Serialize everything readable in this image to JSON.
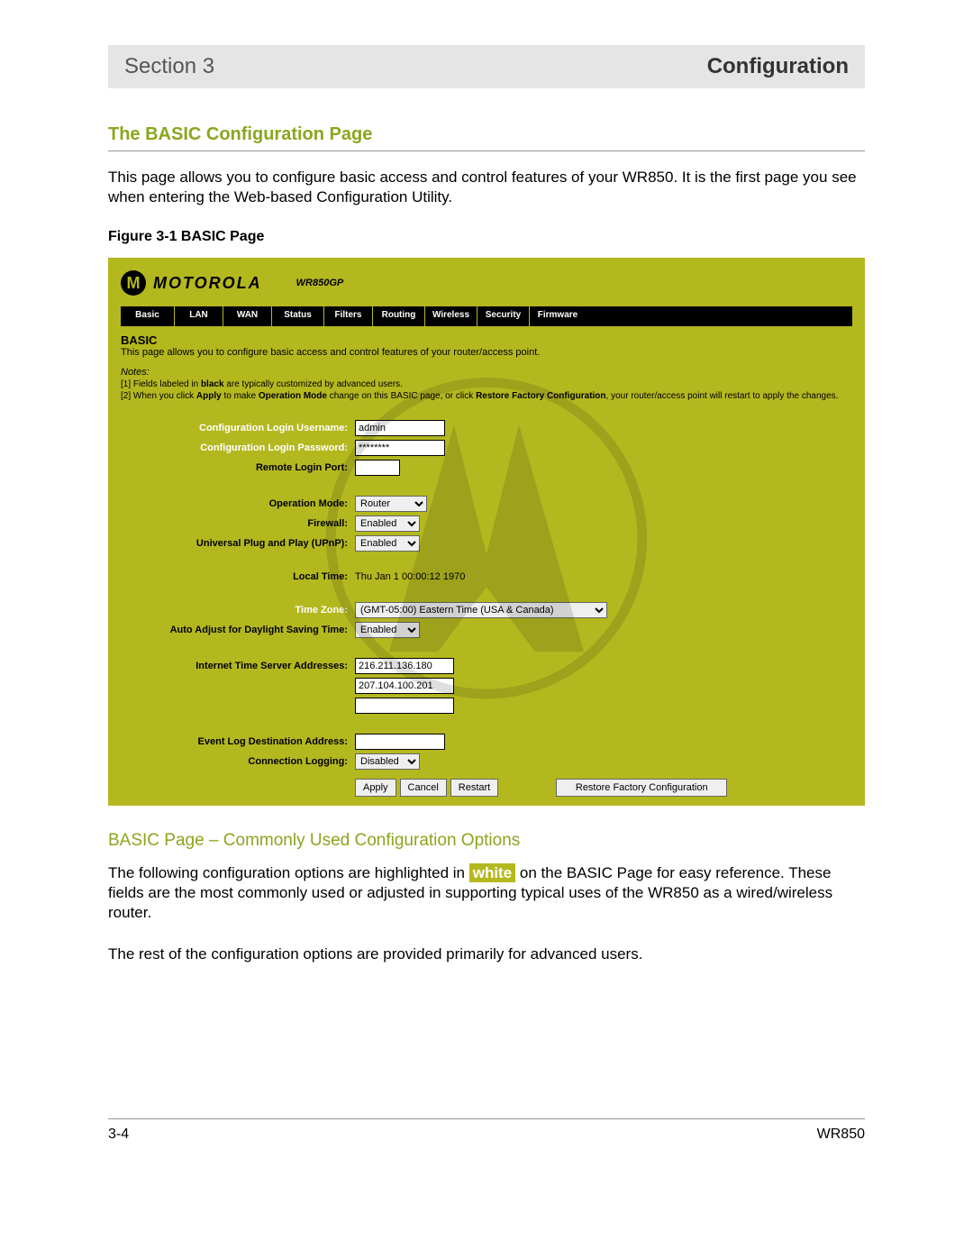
{
  "header": {
    "section_label": "Section 3",
    "module_label": "Configuration"
  },
  "title": "The BASIC Configuration Page",
  "intro": "This page allows you to configure basic access and control features of your WR850.  It is the first page you see when entering the Web-based Configuration Utility.",
  "figure_caption": "Figure 3-1 BASIC Page",
  "router": {
    "brand": "MOTOROLA",
    "model": "WR850GP",
    "tabs": [
      "Basic",
      "LAN",
      "WAN",
      "Status",
      "Filters",
      "Routing",
      "Wireless",
      "Security",
      "Firmware"
    ],
    "section_title": "BASIC",
    "desc": "This page allows you to configure basic access and control features of your router/access point.",
    "notes_label": "Notes:",
    "note1_pre": "[1] Fields labeled in ",
    "note1_bold": "black",
    "note1_post": " are typically customized by advanced users.",
    "note2_pre": "[2] When you click ",
    "note2_apply": "Apply",
    "note2_mid": " to make ",
    "note2_om": "Operation Mode",
    "note2_mid2": " change on this BASIC page, or click ",
    "note2_rfc": "Restore Factory Configuration",
    "note2_post": ", your router/access point will restart to apply the changes.",
    "labels": {
      "username": "Configuration Login Username:",
      "password": "Configuration Login Password:",
      "remote_port": "Remote Login Port:",
      "op_mode": "Operation Mode:",
      "firewall": "Firewall:",
      "upnp": "Universal Plug and Play (UPnP):",
      "local_time": "Local Time:",
      "timezone": "Time Zone:",
      "dst": "Auto Adjust for Daylight Saving Time:",
      "its": "Internet Time Server Addresses:",
      "evlog": "Event Log Destination Address:",
      "connlog": "Connection Logging:"
    },
    "values": {
      "username": "admin",
      "password": "********",
      "remote_port": "",
      "op_mode": "Router",
      "firewall": "Enabled",
      "upnp": "Enabled",
      "local_time": "Thu Jan 1 00:00:12 1970",
      "timezone": "(GMT-05:00) Eastern Time (USA & Canada)",
      "dst": "Enabled",
      "its1": "216.211.136.180",
      "its2": "207.104.100.201",
      "its3": "",
      "evlog": "",
      "connlog": "Disabled"
    },
    "buttons": {
      "apply": "Apply",
      "cancel": "Cancel",
      "restart": "Restart",
      "restore": "Restore Factory Configuration"
    }
  },
  "subheading": "BASIC Page – Commonly Used Configuration Options",
  "para2_pre": "The following configuration options are highlighted in ",
  "para2_chip": "white",
  "para2_post": " on the BASIC Page for easy reference.  These fields are the most commonly used or adjusted in supporting typical uses of the WR850 as a wired/wireless router.",
  "para3": "The rest of the configuration options are provided primarily for advanced users.",
  "footer": {
    "page": "3-4",
    "product": "WR850"
  }
}
